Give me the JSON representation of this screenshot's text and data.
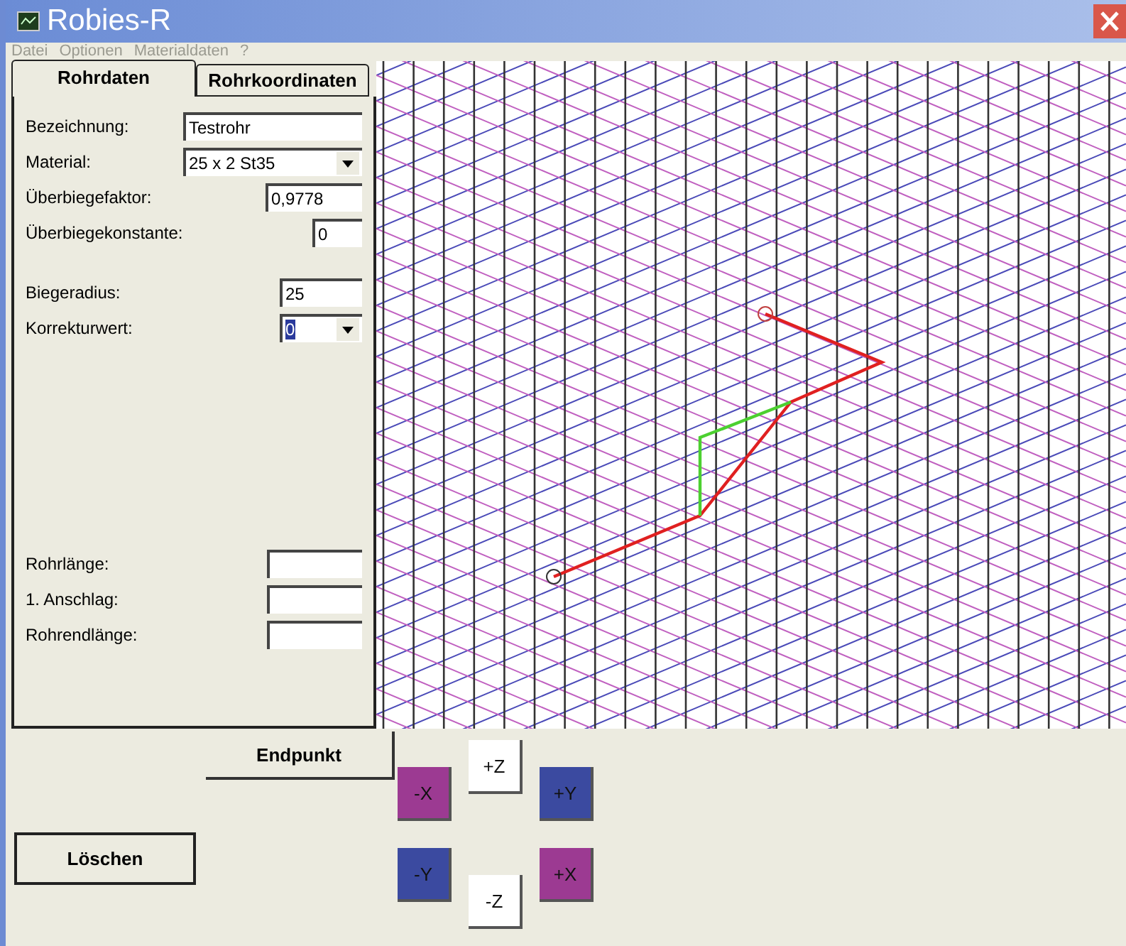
{
  "window": {
    "title": "Robies-R"
  },
  "menu": [
    {
      "label": "Datei",
      "disabled": true
    },
    {
      "label": "Optionen",
      "disabled": true
    },
    {
      "label": "Materialdaten",
      "disabled": true
    },
    {
      "label": "?",
      "disabled": true
    }
  ],
  "tabs": [
    {
      "label": "Rohrdaten",
      "selected": true
    },
    {
      "label": "Rohrkoordinaten",
      "selected": false
    }
  ],
  "field_groups": [
    [
      {
        "label": "Bezeichnung:",
        "value": "Testrohr",
        "kind": "text",
        "text_selected": false
      },
      {
        "label": "Material:",
        "value": "25 x 2 St35",
        "kind": "dropdown",
        "text_selected": false
      },
      {
        "label": "Überbiegefaktor:",
        "value": "0,9778",
        "kind": "text",
        "text_selected": false
      },
      {
        "label": "Überbiegekonstante:",
        "value": "0",
        "kind": "text",
        "text_selected": false
      }
    ],
    [
      {
        "label": "Biegeradius:",
        "value": "25",
        "kind": "text",
        "text_selected": false
      },
      {
        "label": "Korrekturwert:",
        "value": "0",
        "kind": "dropdown",
        "text_selected": true
      }
    ],
    [
      {
        "label": "Rohrlänge:",
        "kind": "text"
      },
      {
        "label": "1. Anschlag:",
        "kind": "text"
      },
      {
        "label": "Rohrendlänge:",
        "kind": "text"
      }
    ]
  ],
  "buttons": [
    {
      "label": "Endpunkt"
    },
    {
      "label": "Löschen"
    }
  ],
  "direction_buttons": [
    {
      "label": "+Z",
      "color": "#ffffff"
    },
    {
      "label": "-X",
      "color": "#9c3a92"
    },
    {
      "label": "+Y",
      "color": "#3b4aa0"
    },
    {
      "label": "-Y",
      "color": "#3b4aa0"
    },
    {
      "label": "+X",
      "color": "#9c3a92"
    },
    {
      "label": "-Z",
      "color": "#ffffff"
    }
  ]
}
